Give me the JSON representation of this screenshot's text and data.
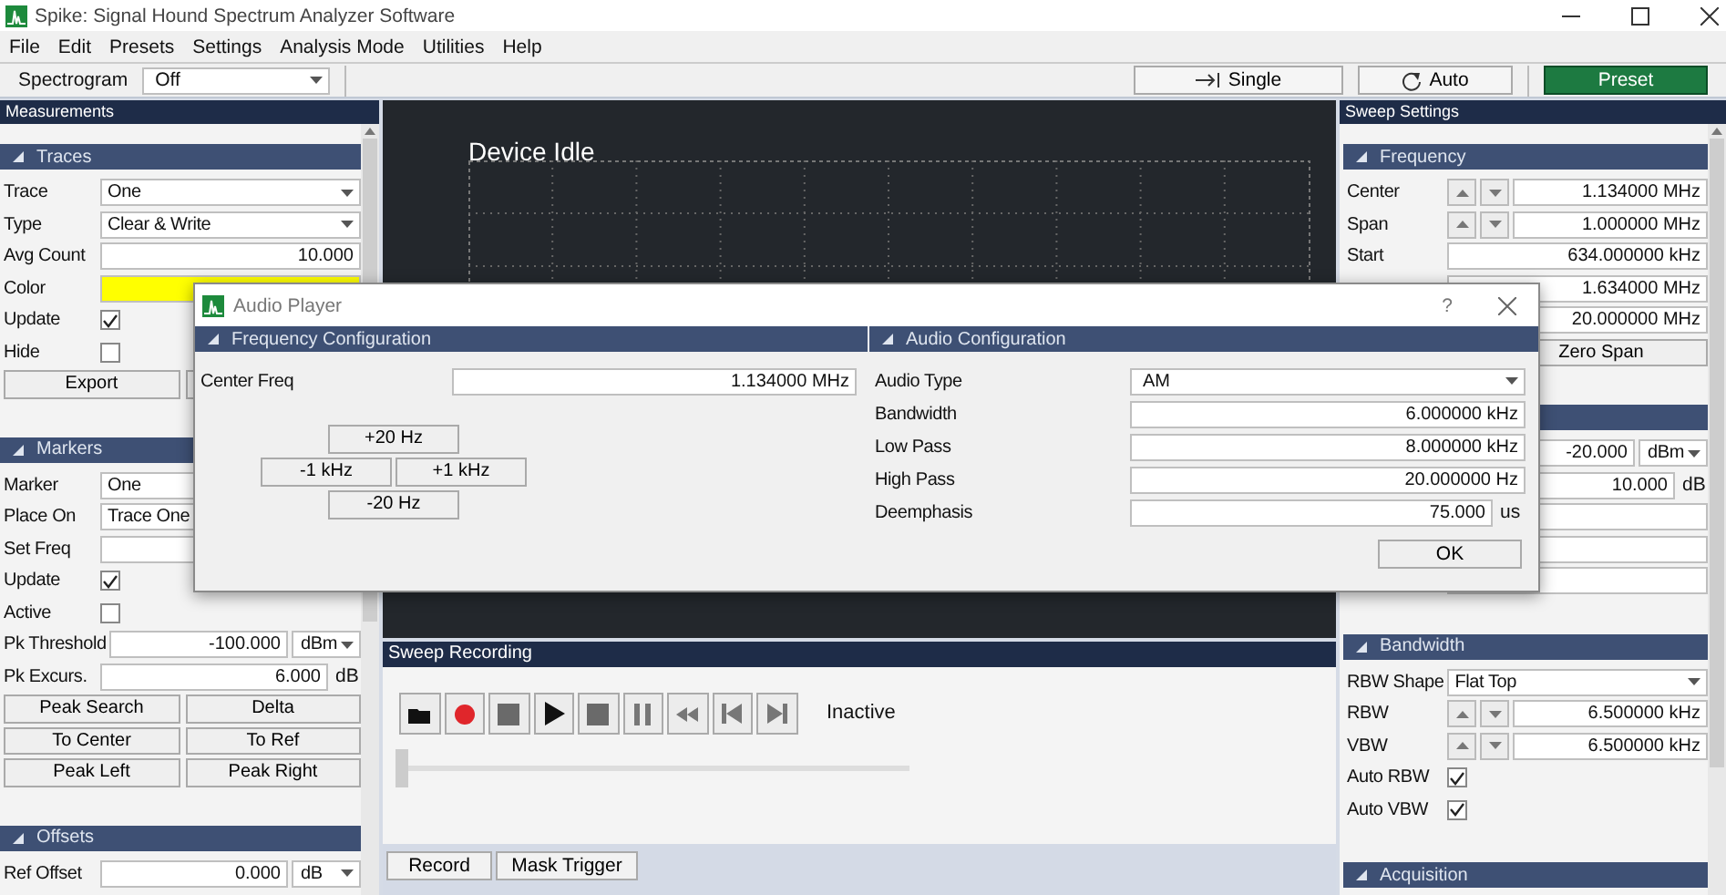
{
  "window": {
    "title": "Spike: Signal Hound Spectrum Analyzer Software"
  },
  "menu": [
    "File",
    "Edit",
    "Presets",
    "Settings",
    "Analysis Mode",
    "Utilities",
    "Help"
  ],
  "toolbar": {
    "spectrogram_label": "Spectrogram",
    "spectrogram_value": "Off",
    "buttons": [
      {
        "label": "Single",
        "kind": "single"
      },
      {
        "label": "Auto",
        "kind": "auto"
      },
      {
        "label": "Preset",
        "kind": "preset"
      }
    ]
  },
  "left_panel": {
    "title": "Measurements",
    "sections": [
      {
        "title": "Traces",
        "rows": [
          {
            "kind": "select",
            "label": "Trace",
            "value": "One"
          },
          {
            "kind": "select",
            "label": "Type",
            "value": "Clear & Write"
          },
          {
            "kind": "number",
            "label": "Avg Count",
            "value": "10.000"
          },
          {
            "kind": "color",
            "label": "Color",
            "color": "#ffff00"
          },
          {
            "kind": "checkbox",
            "label": "Update",
            "checked": true
          },
          {
            "kind": "checkbox",
            "label": "Hide",
            "checked": false
          },
          {
            "kind": "buttons",
            "labels": [
              "Export"
            ]
          }
        ]
      },
      {
        "title": "Markers",
        "rows": [
          {
            "kind": "select",
            "label": "Marker",
            "value": "One"
          },
          {
            "kind": "select",
            "label": "Place On",
            "value": "Trace One"
          },
          {
            "kind": "number",
            "label": "Set Freq"
          },
          {
            "kind": "checkbox",
            "label": "Update",
            "checked": true
          },
          {
            "kind": "checkbox",
            "label": "Active",
            "checked": false
          },
          {
            "kind": "number",
            "label": "Pk Threshold",
            "value": "-100.000",
            "unit_dropdown": "dBm"
          },
          {
            "kind": "number",
            "label": "Pk Excurs.",
            "value": "6.000",
            "unit": "dB"
          },
          {
            "kind": "buttons",
            "labels": [
              "Peak Search",
              "Delta"
            ]
          },
          {
            "kind": "buttons",
            "labels": [
              "To Center",
              "To Ref"
            ]
          },
          {
            "kind": "buttons",
            "labels": [
              "Peak Left",
              "Peak Right"
            ]
          }
        ]
      },
      {
        "title": "Offsets",
        "rows": [
          {
            "kind": "number",
            "label": "Ref Offset",
            "value": "0.000",
            "unit_dropdown": "dB"
          }
        ]
      }
    ]
  },
  "display": {
    "status": "Device Idle"
  },
  "sweep_recording": {
    "title": "Sweep Recording",
    "controls": [
      {
        "kind": "open"
      },
      {
        "kind": "record"
      },
      {
        "kind": "stop"
      },
      {
        "kind": "play"
      },
      {
        "kind": "stop"
      },
      {
        "kind": "pause"
      },
      {
        "kind": "rewind"
      },
      {
        "kind": "previous"
      },
      {
        "kind": "next"
      }
    ],
    "state": "Inactive",
    "slider": {
      "level": 0
    }
  },
  "bottom_buttons": [
    "Record",
    "Mask Trigger"
  ],
  "right_panel": {
    "title": "Sweep Settings",
    "sections": [
      {
        "title": "Frequency",
        "rows": [
          {
            "kind": "spin",
            "label": "Center",
            "value": "1.134000 MHz"
          },
          {
            "kind": "spin",
            "label": "Span",
            "value": "1.000000 MHz"
          },
          {
            "kind": "number",
            "label": "Start",
            "value": "634.000000 kHz"
          },
          {
            "kind": "number",
            "value": "1.634000 MHz"
          },
          {
            "kind": "number",
            "value": "20.000000 MHz"
          },
          {
            "kind": "button",
            "label": "Zero Span"
          }
        ]
      },
      {
        "rows": [
          {
            "kind": "number",
            "value": "-20.000",
            "unit_dropdown": "dBm"
          },
          {
            "kind": "number",
            "value": "10.000",
            "unit": "dB"
          },
          {
            "kind": "select"
          },
          {
            "kind": "select"
          },
          {
            "kind": "select"
          }
        ]
      },
      {
        "title": "Bandwidth",
        "rows": [
          {
            "kind": "select",
            "label": "RBW Shape",
            "value": "Flat Top"
          },
          {
            "kind": "spin",
            "label": "RBW",
            "value": "6.500000 kHz"
          },
          {
            "kind": "spin",
            "label": "VBW",
            "value": "6.500000 kHz"
          },
          {
            "kind": "checkbox",
            "label": "Auto RBW",
            "checked": true
          },
          {
            "kind": "checkbox",
            "label": "Auto VBW",
            "checked": true
          }
        ]
      },
      {
        "title": "Acquisition"
      }
    ]
  },
  "dialog": {
    "title": "Audio Player",
    "help": "?",
    "frequency": {
      "title": "Frequency Configuration",
      "label": "Center Freq",
      "value": "1.134000 MHz",
      "steps": [
        "+20 Hz",
        "-1 kHz",
        "+1 kHz",
        "-20 Hz"
      ]
    },
    "audio": {
      "title": "Audio Configuration",
      "rows": [
        {
          "kind": "select",
          "label": "Audio Type",
          "value": "AM"
        },
        {
          "kind": "number",
          "label": "Bandwidth",
          "value": "6.000000 kHz"
        },
        {
          "kind": "number",
          "label": "Low Pass",
          "value": "8.000000 kHz"
        },
        {
          "kind": "number",
          "label": "High Pass",
          "value": "20.000000 Hz"
        },
        {
          "kind": "number",
          "label": "Deemphasis",
          "value": "75.000",
          "unit": "us"
        }
      ]
    },
    "ok": "OK"
  }
}
